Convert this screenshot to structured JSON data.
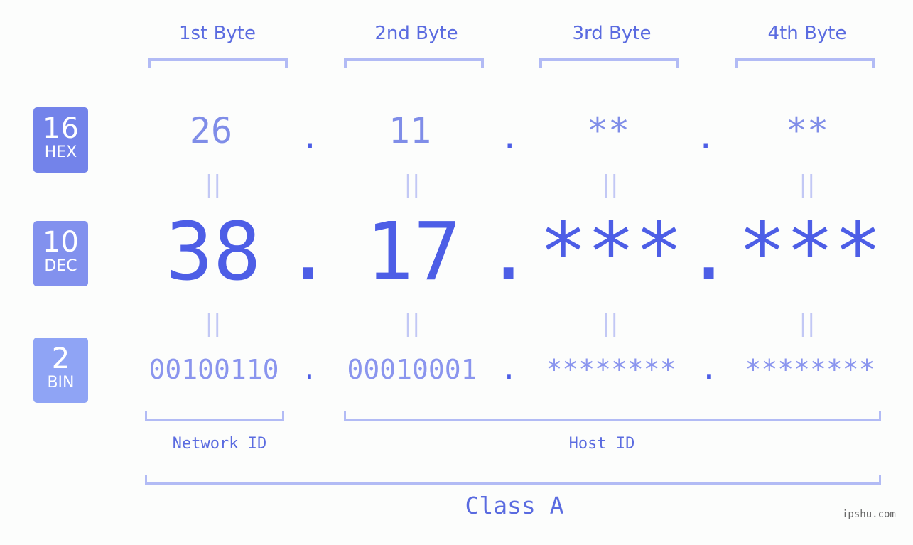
{
  "bases": [
    {
      "number": "16",
      "label": "HEX",
      "color": "#7383ea"
    },
    {
      "number": "10",
      "label": "DEC",
      "color": "#8291ee"
    },
    {
      "number": "2",
      "label": "BIN",
      "color": "#8fa4f5"
    }
  ],
  "bytes": [
    {
      "title": "1st Byte",
      "hex": "26",
      "dec": "38",
      "bin": "00100110"
    },
    {
      "title": "2nd Byte",
      "hex": "11",
      "dec": "17",
      "bin": "00010001"
    },
    {
      "title": "3rd Byte",
      "hex": "**",
      "dec": "***",
      "bin": "********"
    },
    {
      "title": "4th Byte",
      "hex": "**",
      "dec": "***",
      "bin": "********"
    }
  ],
  "separator": ".",
  "equals": "||",
  "network_id_label": "Network ID",
  "host_id_label": "Host ID",
  "class_label": "Class A",
  "watermark": "ipshu.com"
}
